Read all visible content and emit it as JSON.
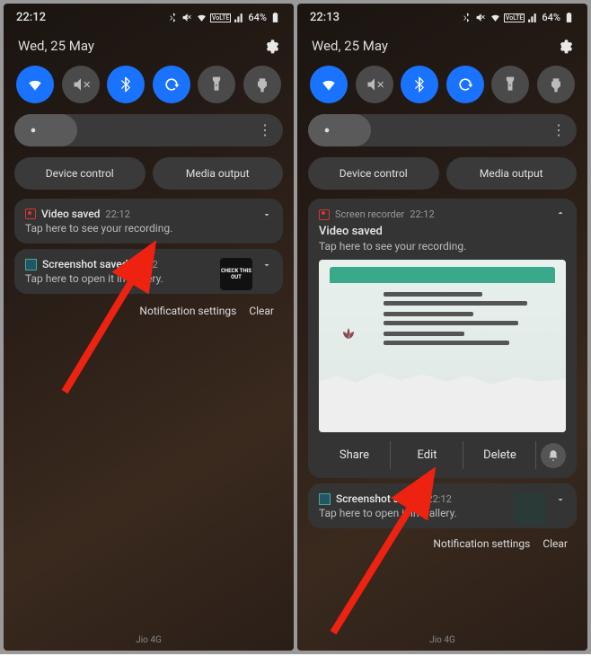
{
  "left": {
    "time": "22:12",
    "battery": "64%",
    "date": "Wed, 25 May",
    "device_control": "Device control",
    "media_output": "Media output",
    "n1_title": "Video saved",
    "n1_time": "22:12",
    "n1_sub": "Tap here to see your recording.",
    "n2_title": "Screenshot saved",
    "n2_time": "22:12",
    "n2_sub": "Tap here to open it in Gallery.",
    "thumb_text": "CHECK THIS OUT",
    "notif_settings": "Notification settings",
    "clear": "Clear",
    "carrier": "Jio 4G"
  },
  "right": {
    "time": "22:13",
    "battery": "64%",
    "date": "Wed, 25 May",
    "device_control": "Device control",
    "media_output": "Media output",
    "app_name": "Screen recorder",
    "app_time": "22:12",
    "n1_title": "Video saved",
    "n1_sub": "Tap here to see your recording.",
    "share": "Share",
    "edit": "Edit",
    "delete": "Delete",
    "n2_title": "Screenshot saved",
    "n2_time": "22:12",
    "n2_sub": "Tap here to open it in Gallery.",
    "notif_settings": "Notification settings",
    "clear": "Clear",
    "carrier": "Jio 4G"
  },
  "status_lte": "VoLTE"
}
